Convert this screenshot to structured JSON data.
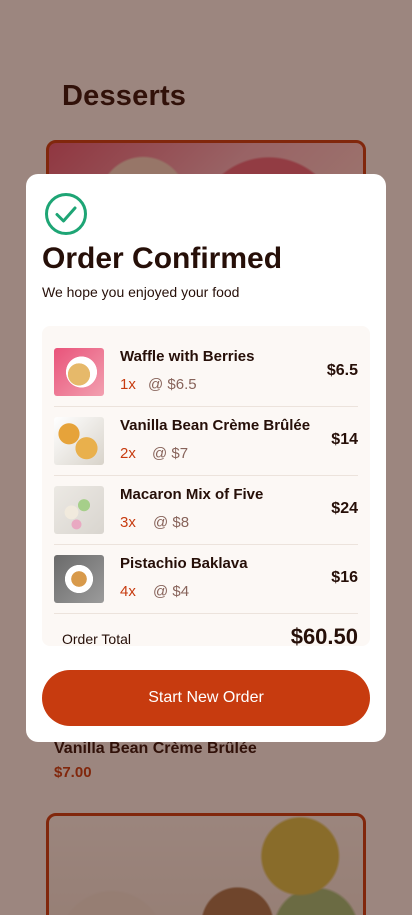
{
  "background": {
    "page_title": "Desserts",
    "visible_item": {
      "name": "Vanilla Bean Crème Brûlée",
      "price": "$7.00"
    }
  },
  "modal": {
    "icon": "check-circle-icon",
    "title": "Order Confirmed",
    "subtitle": "We hope you enjoyed your food",
    "items": [
      {
        "name": "Waffle with Berries",
        "qty": "1x",
        "unit_price": "@ $6.5",
        "total": "$6.5"
      },
      {
        "name": "Vanilla Bean Crème Brûlée",
        "qty": "2x",
        "unit_price": "@ $7",
        "total": "$14"
      },
      {
        "name": "Macaron Mix of Five",
        "qty": "3x",
        "unit_price": "@ $8",
        "total": "$24"
      },
      {
        "name": "Pistachio Baklava",
        "qty": "4x",
        "unit_price": "@ $4",
        "total": "$16"
      }
    ],
    "order_total_label": "Order Total",
    "order_total_value": "$60.50",
    "start_button_label": "Start New Order"
  },
  "colors": {
    "accent": "#c73b0f",
    "success": "#1ea575",
    "text_dark": "#260f08",
    "text_muted": "#87635a",
    "panel_bg": "#fcf8f5"
  }
}
